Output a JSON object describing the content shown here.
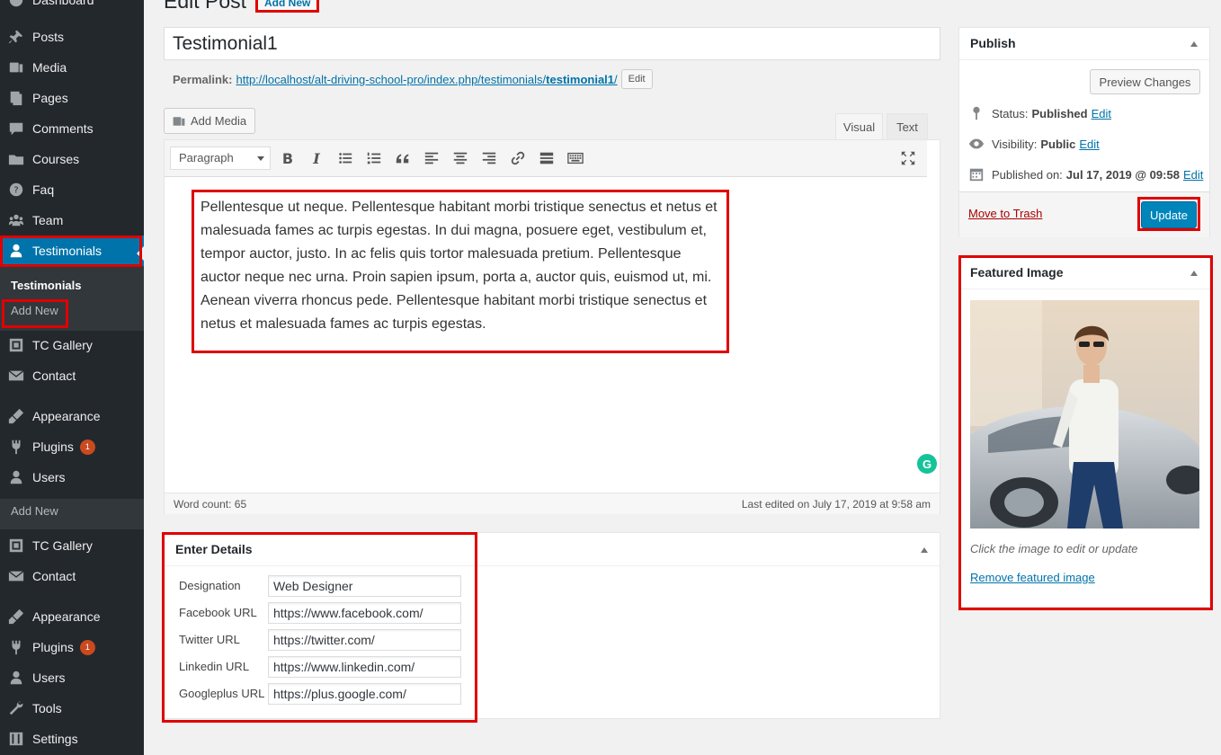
{
  "sidebar": {
    "partial_top": "Dashboard",
    "items": [
      {
        "label": "Posts",
        "icon": "pin-icon"
      },
      {
        "label": "Media",
        "icon": "media-icon"
      },
      {
        "label": "Pages",
        "icon": "pages-icon"
      },
      {
        "label": "Comments",
        "icon": "comments-icon"
      },
      {
        "label": "Courses",
        "icon": "folder-icon"
      },
      {
        "label": "Faq",
        "icon": "help-icon"
      },
      {
        "label": "Team",
        "icon": "groups-icon"
      },
      {
        "label": "Testimonials",
        "icon": "user-icon"
      }
    ],
    "submenu": {
      "current": "Testimonials",
      "add_new": "Add New"
    },
    "items2": [
      {
        "label": "TC Gallery"
      },
      {
        "label": "Contact"
      },
      {
        "label": "Appearance"
      },
      {
        "label": "Plugins",
        "badge": "1"
      },
      {
        "label": "Users"
      }
    ],
    "submenu2": {
      "add_new": "Add New"
    },
    "items3": [
      {
        "label": "TC Gallery"
      },
      {
        "label": "Contact"
      },
      {
        "label": "Appearance"
      },
      {
        "label": "Plugins",
        "badge": "1"
      },
      {
        "label": "Users"
      },
      {
        "label": "Tools"
      },
      {
        "label": "Settings"
      }
    ]
  },
  "header": {
    "title": "Edit Post",
    "add_new": "Add New"
  },
  "post": {
    "title": "Testimonial1",
    "permalink_label": "Permalink:",
    "permalink_base": "http://localhost/alt-driving-school-pro/index.php/testimonials/",
    "permalink_slug": "testimonial1",
    "permalink_end": "/",
    "permalink_edit": "Edit"
  },
  "editor": {
    "add_media": "Add Media",
    "tab_visual": "Visual",
    "tab_text": "Text",
    "format": "Paragraph",
    "content": "Pellentesque ut neque. Pellentesque habitant morbi tristique senectus et netus et malesuada fames ac turpis egestas. In dui magna, posuere eget, vestibulum et, tempor auctor, justo. In ac felis quis tortor malesuada pretium. Pellentesque auctor neque nec urna. Proin sapien ipsum, porta a, auctor quis, euismod ut, mi. Aenean viverra rhoncus pede. Pellentesque habitant morbi tristique senectus et netus et malesuada fames ac turpis egestas.",
    "word_count": "Word count: 65",
    "last_edited": "Last edited on July 17, 2019 at 9:58 am",
    "grammarly": "G"
  },
  "details": {
    "title": "Enter Details",
    "fields": [
      {
        "label": "Designation",
        "value": "Web Designer"
      },
      {
        "label": "Facebook URL",
        "value": "https://www.facebook.com/"
      },
      {
        "label": "Twitter URL",
        "value": "https://twitter.com/"
      },
      {
        "label": "Linkedin URL",
        "value": "https://www.linkedin.com/"
      },
      {
        "label": "Googleplus URL",
        "value": "https://plus.google.com/"
      }
    ]
  },
  "publish": {
    "title": "Publish",
    "preview": "Preview Changes",
    "status_label": "Status:",
    "status_value": "Published",
    "visibility_label": "Visibility:",
    "visibility_value": "Public",
    "published_label": "Published on:",
    "published_value": "Jul 17, 2019 @ 09:58",
    "edit": "Edit",
    "trash": "Move to Trash",
    "update": "Update"
  },
  "featured": {
    "title": "Featured Image",
    "caption": "Click the image to edit or update",
    "remove": "Remove featured image"
  },
  "colors": {
    "accent": "#0073aa",
    "highlight": "#e00000",
    "sidebar": "#23282d"
  }
}
